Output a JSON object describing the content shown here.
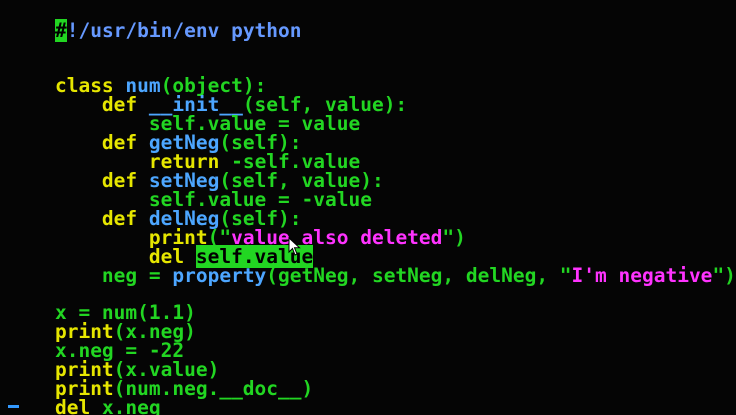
{
  "code": {
    "l1": {
      "cursor_char": "#",
      "rest": "!/usr/bin/env python"
    },
    "l3": {
      "kw": "class ",
      "name": "num",
      "rest": "(object):"
    },
    "l4": {
      "kw": "    def ",
      "name": "__init__",
      "rest": "(self, value):"
    },
    "l5": {
      "text": "        self.value = value"
    },
    "l6": {
      "kw": "    def ",
      "name": "getNeg",
      "rest": "(self):"
    },
    "l7": {
      "kw": "        return",
      "rest": " -self.value"
    },
    "l8": {
      "kw": "    def ",
      "name": "setNeg",
      "rest": "(self, value):"
    },
    "l9": {
      "text": "        self.value = -value"
    },
    "l10": {
      "kw": "    def ",
      "name": "delNeg",
      "rest": "(self):"
    },
    "l11": {
      "kw": "        print",
      "open": "(\"",
      "str": "value also deleted",
      "close": "\")"
    },
    "l12": {
      "kw": "        del ",
      "selected": "self.value"
    },
    "l13": {
      "pre": "    neg = ",
      "fn": "property",
      "args": "(getNeg, setNeg, delNeg, \"",
      "str": "I'm negative",
      "close": "\")"
    },
    "l15": {
      "text": "x = num(1.1)"
    },
    "l16": {
      "kw": "print",
      "rest": "(x.neg)"
    },
    "l17": {
      "text": "x.neg = -22"
    },
    "l18": {
      "kw": "print",
      "rest": "(x.value)"
    },
    "l19": {
      "kw": "print",
      "rest": "(num.neg.__doc__)"
    },
    "l20": {
      "kw": "del",
      "rest": " x.neg"
    }
  },
  "colors": {
    "background": "#050505",
    "plain": "#22d622",
    "keyword": "#e6e600",
    "function": "#4da6ff",
    "string": "#ff33ff",
    "shebang": "#6699ff"
  },
  "icons": {
    "pointer": "mouse-pointer-icon"
  }
}
